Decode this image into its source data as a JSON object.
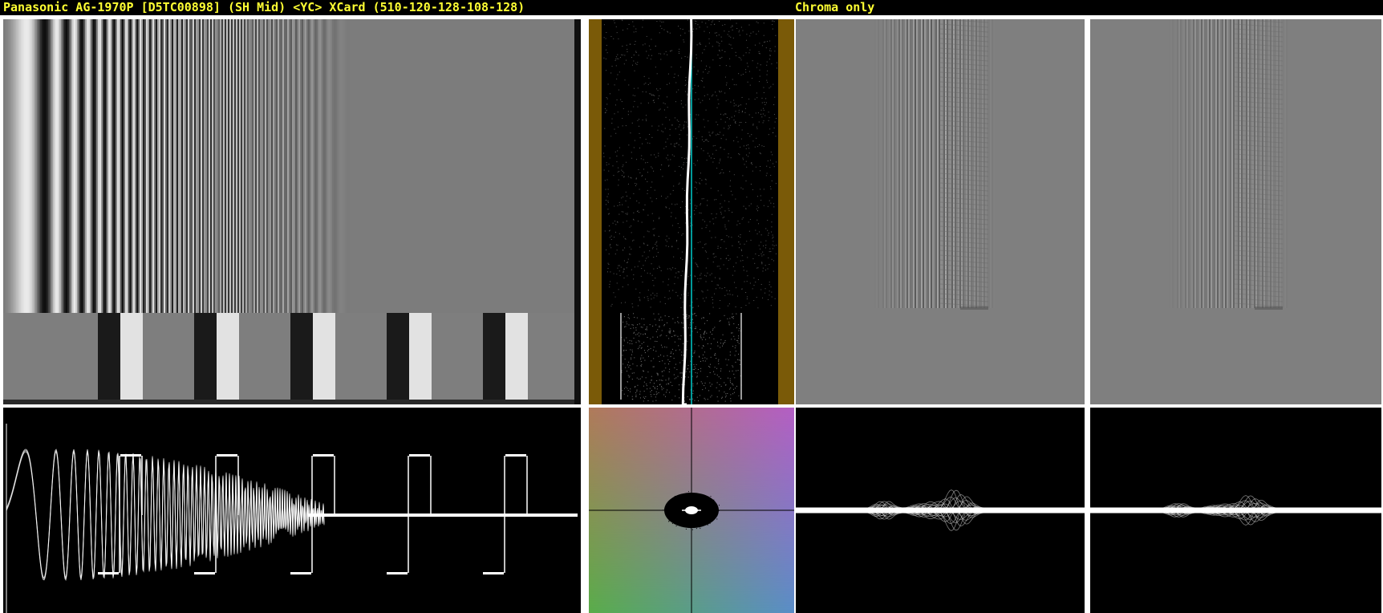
{
  "header": {
    "left_title": "Panasonic AG-1970P [D5TC00898] (SH Mid) <YC> XCard (510-120-128-108-128)",
    "right_title": "Chroma only"
  },
  "colors": {
    "title_text": "#ffff33",
    "background": "#000000",
    "separator": "#ffffff",
    "histogram_side_bar": "#7a5a08",
    "histogram_marker": "#00cccc",
    "chroma_gray": "#7f7f7f"
  },
  "panels": {
    "picture": "luma-test-pattern",
    "histogram": "horizontal-position-histogram",
    "chroma_u": "chroma-u-image",
    "chroma_v": "chroma-v-image",
    "waveform": "luma-waveform",
    "vectorscope": "vectorscope",
    "chroma_u_waveform": "chroma-u-waveform",
    "chroma_v_waveform": "chroma-v-waveform"
  }
}
